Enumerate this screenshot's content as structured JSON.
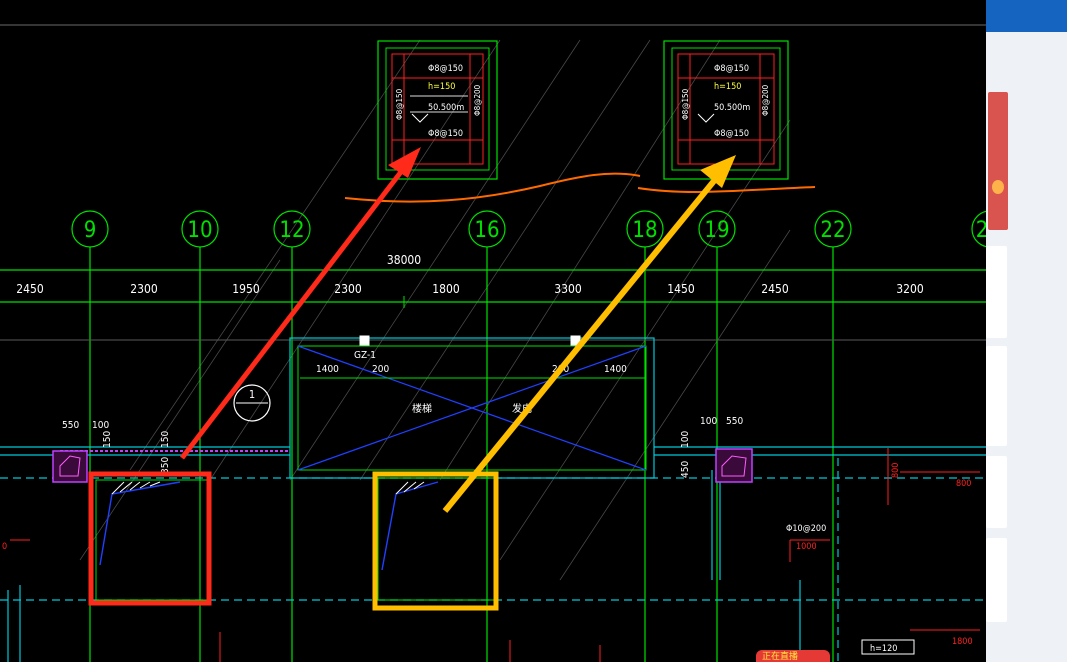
{
  "drawing": {
    "grid_axes": [
      "9",
      "10",
      "12",
      "16",
      "18",
      "19",
      "22",
      "2"
    ],
    "total_dimension": "38000",
    "spans": [
      "2450",
      "2300",
      "1950",
      "2300",
      "1800",
      "3300",
      "1450",
      "2450",
      "3200"
    ],
    "pit_details": [
      {
        "top_rebar": "Φ8@150",
        "height": "h=150",
        "level": "50.500m",
        "bottom_rebar": "Φ8@150",
        "left_rebar": "Φ8@150",
        "right_rebar": "Φ8@200"
      },
      {
        "top_rebar": "Φ8@150",
        "height": "h=150",
        "level": "50.500m",
        "bottom_rebar": "Φ8@150",
        "left_rebar": "Φ8@150",
        "right_rebar": "Φ8@200"
      }
    ],
    "plan_labels": {
      "gz": "GZ-1",
      "dim_1400_left": "1400",
      "dim_200_left": "200",
      "dim_200_right": "200",
      "dim_1400_right": "1400",
      "stair_label": "楼梯",
      "stair_label_2": "发电",
      "dim_550_left": "550",
      "dim_100_left": "100",
      "dim_100_right": "100",
      "dim_550_right": "550",
      "dim_150_a": "150",
      "dim_350": "350",
      "dim_150_b": "150",
      "dim_450": "450",
      "dim_100_v": "100",
      "section_mark": "1",
      "rebar_right": "Φ10@200",
      "dim_1000": "1000",
      "dim_800_top": "800",
      "dim_800_right": "800",
      "dim_1800": "1800",
      "plate_h": "h=120",
      "edge_left": "0"
    },
    "colors": {
      "grid": "#00e000",
      "red_arrow": "#ff2a1a",
      "yellow_arrow": "#ffbe00",
      "wall": "#00c8d8",
      "orange_line": "#ff6a00"
    }
  },
  "sidebar": {
    "live_badge": "正在直播"
  }
}
